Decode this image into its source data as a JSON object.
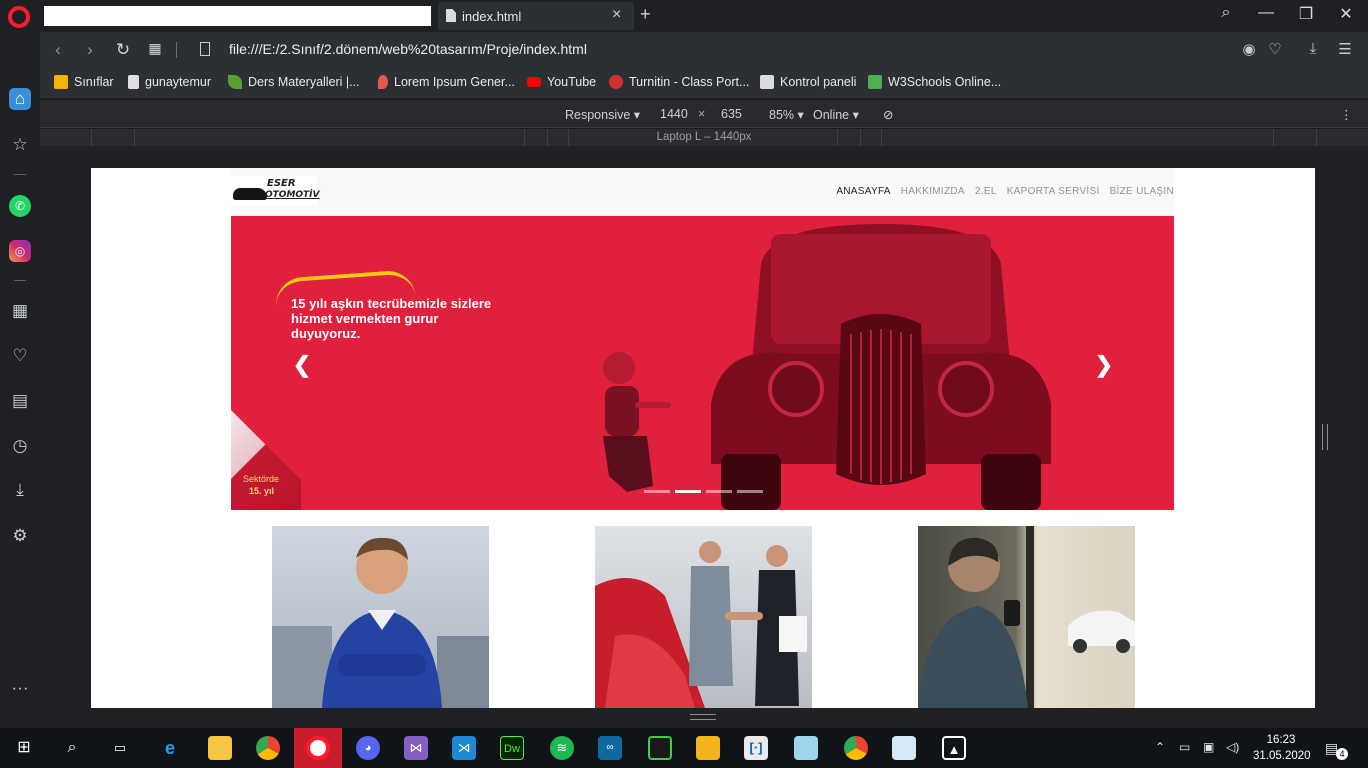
{
  "browser": {
    "tab": {
      "title": "index.html",
      "close_icon": "×",
      "new_tab_icon": "+"
    },
    "window_controls": {
      "search": "⌕",
      "minimize": "—",
      "restore": "❐",
      "close": "✕"
    },
    "address": "file:///E:/2.Sınıf/2.dönem/web%20tasarım/Proje/index.html",
    "bookmarks": [
      {
        "label": "Sınıflar",
        "icon": "classroom-icon",
        "color": "#f4b400"
      },
      {
        "label": "gunaytemur",
        "icon": "page-icon",
        "color": "#e0e0e0"
      },
      {
        "label": "Ders Materyalleri |...",
        "icon": "leaf-icon",
        "color": "#5aa02c"
      },
      {
        "label": "Lorem Ipsum Gener...",
        "icon": "pin-icon",
        "color": "#e8554e"
      },
      {
        "label": "YouTube",
        "icon": "youtube-icon",
        "color": "#ff0000"
      },
      {
        "label": "Turnitin - Class Port...",
        "icon": "turnitin-icon",
        "color": "#d32f2f"
      },
      {
        "label": "Kontrol paneli",
        "icon": "panel-icon",
        "color": "#dcdcdc"
      },
      {
        "label": "W3Schools Online...",
        "icon": "w3-icon",
        "color": "#4caf50"
      }
    ]
  },
  "devtools": {
    "mode": "Responsive",
    "width": "1440",
    "times": "×",
    "height": "635",
    "zoom": "85%",
    "network": "Online",
    "media_label": "Laptop L – 1440px"
  },
  "site": {
    "menu": [
      {
        "label": "ANASAYFA",
        "active": true
      },
      {
        "label": "HAKKIMIZDA",
        "active": false
      },
      {
        "label": "2.EL",
        "active": false
      },
      {
        "label": "KAPORTA SERVİSİ",
        "active": false
      },
      {
        "label": "BİZE ULAŞIN",
        "active": false
      }
    ],
    "logo": {
      "line1": "ESER",
      "line2": "OTOMOTİV"
    },
    "slide": {
      "headline": "15 yılı aşkın tecrübemizle sizlere hizmet vermekten gurur duyuyoruz.",
      "corner_line1": "Sektörde",
      "corner_line2": "15. yıl",
      "prev": "❮",
      "next": "❯",
      "indicator_count": 4,
      "active_indicator": 1
    }
  },
  "taskbar": {
    "time": "16:23",
    "date": "31.05.2020",
    "notifications": "4"
  }
}
